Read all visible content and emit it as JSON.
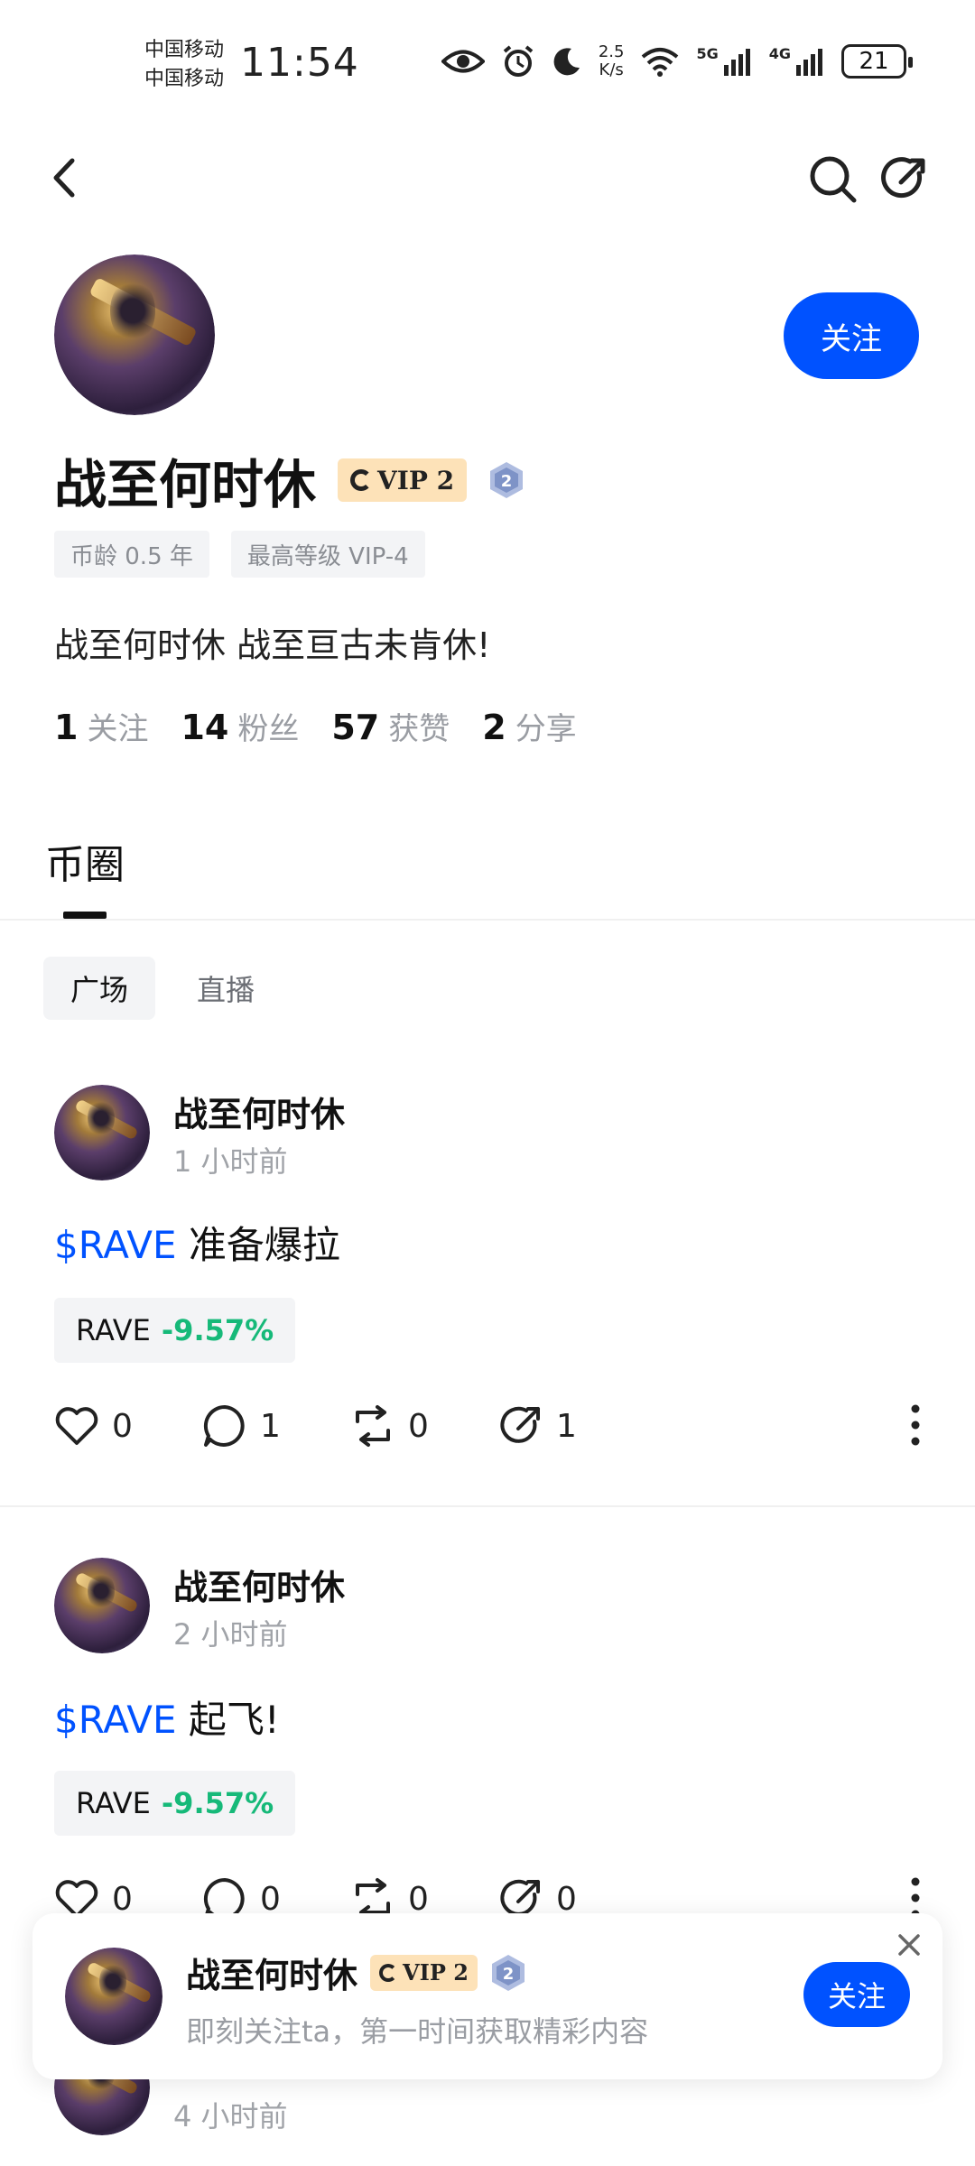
{
  "status_bar": {
    "carrier_1": "中国移动",
    "carrier_2": "中国移动",
    "time": "11:54",
    "net_speed_value": "2.5",
    "net_speed_unit": "K/s",
    "sig1_label": "5G",
    "sig2_label": "4G",
    "battery": "21"
  },
  "profile": {
    "name": "战至何时休",
    "vip_label": "VIP 2",
    "level": "2",
    "follow_label": "关注",
    "tags": [
      "币龄 0.5 年",
      "最高等级 VIP-4"
    ],
    "bio": "战至何时休 战至亘古未肯休!",
    "stats": [
      {
        "num": "1",
        "label": "关注"
      },
      {
        "num": "14",
        "label": "粉丝"
      },
      {
        "num": "57",
        "label": "获赞"
      },
      {
        "num": "2",
        "label": "分享"
      }
    ]
  },
  "tabs": {
    "main": "币圈",
    "sub": [
      "广场",
      "直播"
    ]
  },
  "posts": [
    {
      "author": "战至何时休",
      "time": "1 小时前",
      "cashtag": "$RAVE",
      "text": " 准备爆拉",
      "ticker": "RAVE",
      "change": "-9.57%",
      "likes": "0",
      "comments": "1",
      "reposts": "0",
      "shares": "1"
    },
    {
      "author": "战至何时休",
      "time": "2 小时前",
      "cashtag": "$RAVE",
      "text": " 起飞!",
      "ticker": "RAVE",
      "change": "-9.57%",
      "likes": "0",
      "comments": "0",
      "reposts": "0",
      "shares": "0"
    },
    {
      "time": "4 小时前"
    }
  ],
  "float_card": {
    "name": "战至何时休",
    "vip_label": "VIP 2",
    "level": "2",
    "subtitle": "即刻关注ta，第一时间获取精彩内容",
    "follow_label": "关注"
  },
  "colors": {
    "brand_blue": "#0052ff",
    "positive_green": "#16b979",
    "vip_gold": "#fde2b8"
  }
}
